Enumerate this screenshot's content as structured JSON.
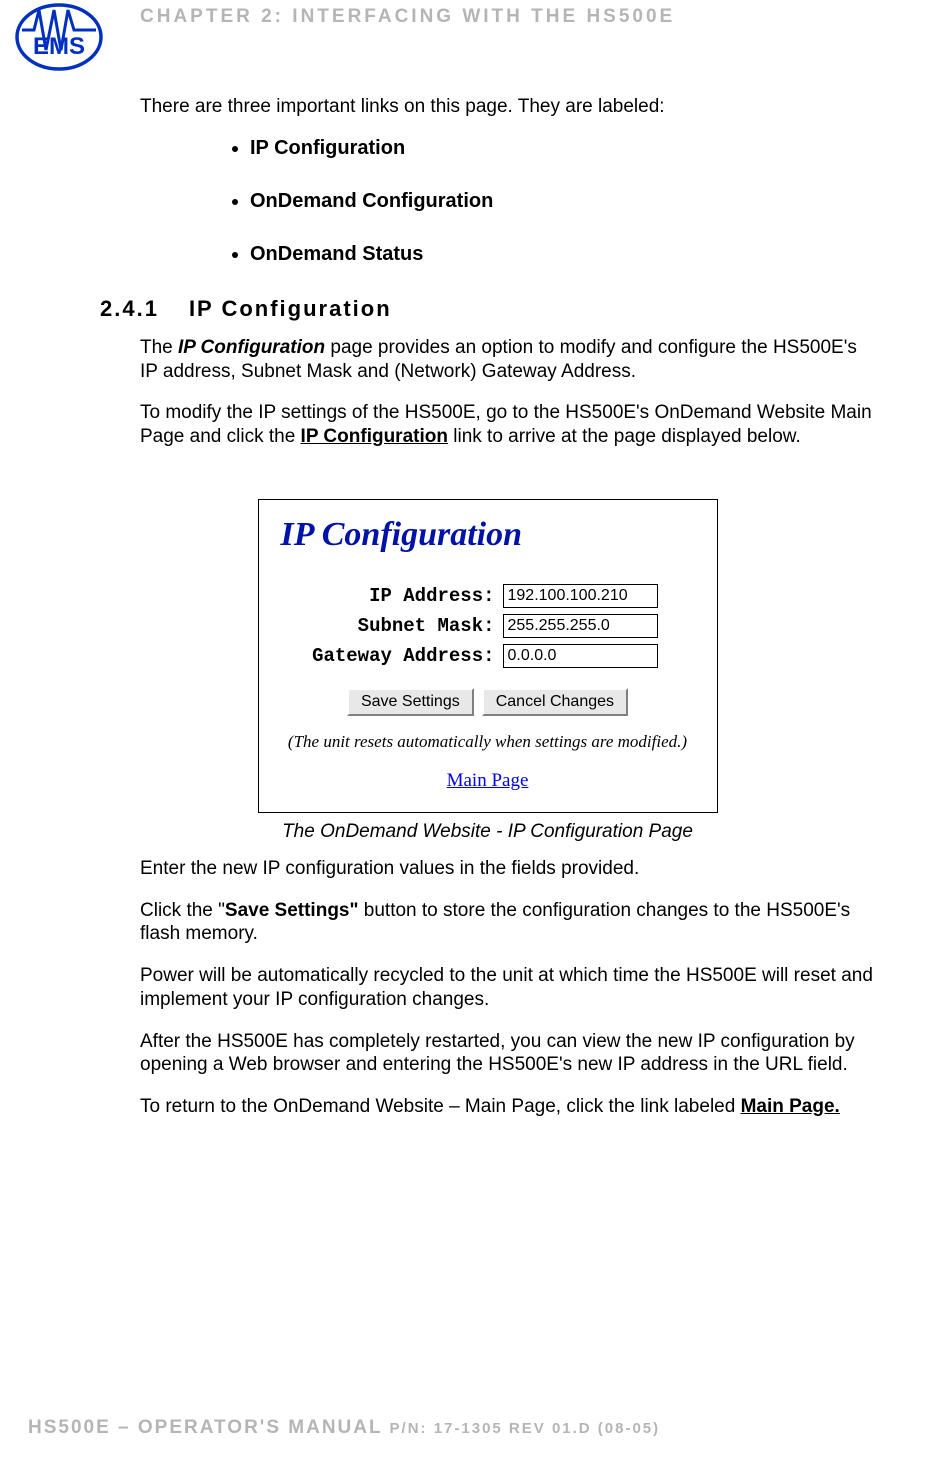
{
  "header": {
    "chapter": "CHAPTER 2: INTERFACING WITH THE HS500E"
  },
  "intro": "There are three important links on this page. They are labeled:",
  "bullets": [
    "IP Configuration",
    "OnDemand Configuration",
    "OnDemand Status"
  ],
  "section": {
    "number": "2.4.1",
    "title": "IP Configuration"
  },
  "para1": {
    "pre": "The ",
    "bold": "IP Configuration",
    "post": " page provides an option to modify and configure the HS500E's IP address, Subnet Mask and (Network) Gateway Address."
  },
  "para2": {
    "pre": "To modify the IP settings of the HS500E, go to the HS500E's OnDemand Website Main Page and click the ",
    "link": "IP Configuration",
    "post": " link to arrive at the page displayed below."
  },
  "figure": {
    "title": "IP Configuration",
    "labels": {
      "ip": "IP Address:",
      "subnet": "Subnet Mask:",
      "gateway": "Gateway Address:"
    },
    "values": {
      "ip": "192.100.100.210",
      "subnet": "255.255.255.0",
      "gateway": "0.0.0.0"
    },
    "buttons": {
      "save": "Save Settings",
      "cancel": "Cancel Changes"
    },
    "note": "(The unit resets automatically when settings are modified.)",
    "link": "Main Page",
    "caption": "The OnDemand Website - IP Configuration Page"
  },
  "para3": "Enter the new IP configuration values in the fields provided.",
  "para4": {
    "pre": "Click the \"",
    "bold": "Save Settings\"",
    "post": " button to store the configuration changes to the HS500E's flash memory."
  },
  "para5": "Power will be automatically recycled to the unit at which time the HS500E will reset and implement your IP configuration changes.",
  "para6": "After the HS500E has completely restarted, you can view the new IP configuration by opening a Web browser and entering the HS500E's new IP address in the URL field.",
  "para7": {
    "pre": "To return to the OnDemand Website – Main Page, click the link labeled ",
    "link": "Main Page."
  },
  "footer": {
    "main": "HS500E – OPERATOR'S MANUAL ",
    "small": "P/N: 17-1305 REV 01.D (08-05)"
  }
}
